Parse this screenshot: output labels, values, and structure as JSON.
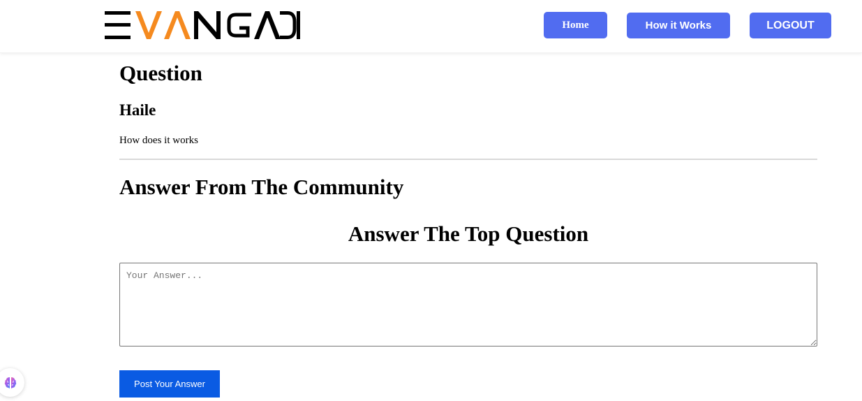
{
  "header": {
    "logo_text": "EVANGADI",
    "nav": {
      "home_label": "Home",
      "how_label": "How it Works",
      "logout_label": "LOGOUT"
    }
  },
  "question": {
    "heading": "Question",
    "user": "Haile",
    "text": "How does it works"
  },
  "community": {
    "heading": "Answer From The Community"
  },
  "answer_form": {
    "heading": "Answer The Top Question",
    "placeholder": "Your Answer...",
    "value": "",
    "submit_label": "Post Your Answer"
  },
  "colors": {
    "nav_button": "#516cf0",
    "post_button": "#0a5be3",
    "logo_accent": "#f58a1f"
  },
  "icons": {
    "floating_widget": "brain-icon"
  }
}
